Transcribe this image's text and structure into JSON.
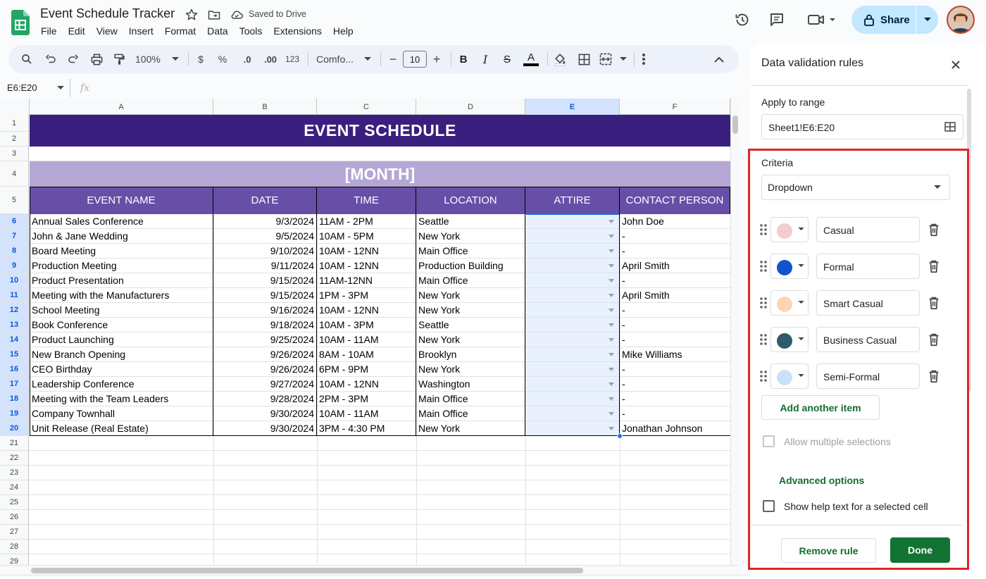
{
  "app": {
    "doc_title": "Event Schedule Tracker",
    "save_status": "Saved to Drive",
    "share_label": "Share"
  },
  "menu": [
    "File",
    "Edit",
    "View",
    "Insert",
    "Format",
    "Data",
    "Tools",
    "Extensions",
    "Help"
  ],
  "toolbar": {
    "zoom": "100%",
    "currency": "$",
    "percent": "%",
    "dec_decrease": ".0",
    "dec_increase": ".00",
    "number_format": "123",
    "font": "Comfo...",
    "font_size": "10",
    "minus": "−",
    "plus": "+",
    "bold": "B",
    "italic": "I",
    "strike": "S",
    "text_color": "A",
    "accent": "#000000"
  },
  "formula_bar": {
    "name_box": "E6:E20",
    "fx": "fx"
  },
  "sheet": {
    "columns": [
      "A",
      "B",
      "C",
      "D",
      "E",
      "F"
    ],
    "rows": [
      "1",
      "2",
      "3",
      "4",
      "5",
      "6",
      "7",
      "8",
      "9",
      "10",
      "11",
      "12",
      "13",
      "14",
      "15",
      "16",
      "17",
      "18",
      "19",
      "20",
      "21",
      "22",
      "23",
      "24",
      "25",
      "26",
      "27",
      "28",
      "29"
    ],
    "banner_title": "EVENT SCHEDULE",
    "month_label": "[MONTH]",
    "headers": [
      "EVENT NAME",
      "DATE",
      "TIME",
      "LOCATION",
      "ATTIRE",
      "CONTACT PERSON"
    ],
    "data_rows": [
      [
        "Annual Sales Conference",
        "9/3/2024",
        "11AM - 2PM",
        "Seattle",
        "",
        "John Doe"
      ],
      [
        "John & Jane Wedding",
        "9/5/2024",
        "10AM - 5PM",
        "New York",
        "",
        "-"
      ],
      [
        "Board Meeting",
        "9/10/2024",
        "10AM - 12NN",
        "Main Office",
        "",
        "-"
      ],
      [
        "Production Meeting",
        "9/11/2024",
        "10AM - 12NN",
        "Production Building",
        "",
        "April Smith"
      ],
      [
        "Product Presentation",
        "9/15/2024",
        "11AM-12NN",
        "Main Office",
        "",
        "-"
      ],
      [
        "Meeting with the Manufacturers",
        "9/15/2024",
        "1PM - 3PM",
        "New York",
        "",
        "April Smith"
      ],
      [
        "School Meeting",
        "9/16/2024",
        "10AM - 12NN",
        "New York",
        "",
        "-"
      ],
      [
        "Book Conference",
        "9/18/2024",
        "10AM - 3PM",
        "Seattle",
        "",
        "-"
      ],
      [
        "Product Launching",
        "9/25/2024",
        "10AM - 11AM",
        "New York",
        "",
        "-"
      ],
      [
        "New Branch Opening",
        "9/26/2024",
        "8AM - 10AM",
        "Brooklyn",
        "",
        "Mike Williams"
      ],
      [
        "CEO Birthday",
        "9/26/2024",
        "6PM - 9PM",
        "New York",
        "",
        "-"
      ],
      [
        "Leadership Conference",
        "9/27/2024",
        "10AM - 12NN",
        "Washington",
        "",
        "-"
      ],
      [
        "Meeting with the Team Leaders",
        "9/28/2024",
        "2PM - 3PM",
        "Main Office",
        "",
        "-"
      ],
      [
        "Company Townhall",
        "9/30/2024",
        "10AM - 11AM",
        "Main Office",
        "",
        "-"
      ],
      [
        "Unit Release (Real Estate)",
        "9/30/2024",
        "3PM - 4:30 PM",
        "New York",
        "",
        "Jonathan Johnson"
      ]
    ],
    "colors": {
      "banner": "#3b1f7e",
      "month_bar": "#b4a7d6",
      "header_bar": "#674ea7",
      "selection": "#e8f0fe"
    }
  },
  "panel": {
    "title": "Data validation rules",
    "apply_label": "Apply to range",
    "range_value": "Sheet1!E6:E20",
    "criteria_label": "Criteria",
    "criteria_value": "Dropdown",
    "items": [
      {
        "value": "Casual",
        "color": "#f4cccc"
      },
      {
        "value": "Formal",
        "color": "#1155cc"
      },
      {
        "value": "Smart Casual",
        "color": "#fcd5b5"
      },
      {
        "value": "Business Casual",
        "color": "#2d5b6b"
      },
      {
        "value": "Semi-Formal",
        "color": "#c9e1f8"
      }
    ],
    "add_item_label": "Add another item",
    "allow_multiple_label": "Allow multiple selections",
    "advanced_label": "Advanced options",
    "help_text_label": "Show help text for a selected cell",
    "remove_label": "Remove rule",
    "done_label": "Done"
  }
}
